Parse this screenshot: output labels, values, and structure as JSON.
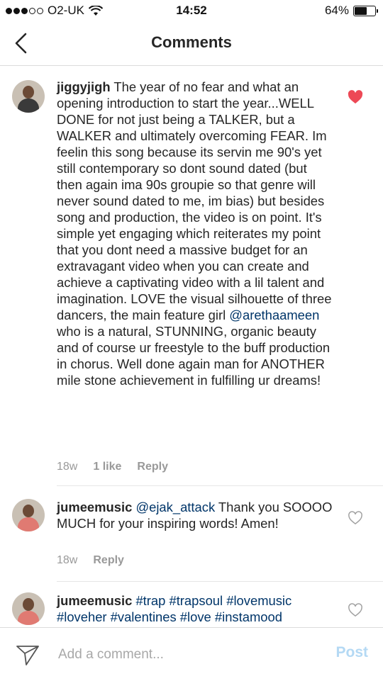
{
  "status_bar": {
    "carrier": "O2-UK",
    "time": "14:52",
    "battery_text": "64%",
    "battery_level": 0.64
  },
  "header": {
    "title": "Comments"
  },
  "comments": [
    {
      "username": "jiggyjigh",
      "text_before": " The year of no fear and what an opening introduction to start the year...WELL DONE for not just being a TALKER, but a WALKER and ultimately overcoming FEAR. Im feelin this song because its servin me 90's yet still contemporary so dont sound dated (but then again ima 90s groupie so that genre will never sound dated to me, im bias) but besides song and production, the video is on point. It's simple yet engaging which reiterates my point that you dont need a massive budget for an extravagant video when you can create and achieve a captivating video with a lil talent and imagination. LOVE the visual silhouette of three dancers, the main feature girl ",
      "mention": "@arethaameen",
      "text_after": " who is a natural, STUNNING, organic beauty and of course ur freestyle to the buff production in chorus. Well done again man for ANOTHER mile stone achievement in fulfilling ur dreams!",
      "time": "18w",
      "likes": "1 like",
      "reply": "Reply",
      "liked": true,
      "heart_color": "#ed4956"
    },
    {
      "username": "jumeemusic",
      "mention": "@ejak_attack",
      "text_after": " Thank you SOOOO MUCH for your inspiring words! Amen!",
      "time": "18w",
      "reply": "Reply",
      "liked": false
    },
    {
      "username": "jumeemusic",
      "hashtags": "#trap #trapsoul #lovemusic #loveher #valentines #love #instamood",
      "liked": false
    }
  ],
  "composer": {
    "placeholder": "Add a comment...",
    "post_label": "Post",
    "post_color": "#b4d9f4"
  },
  "colors": {
    "mention": "#003569",
    "meta_text": "#999999"
  }
}
